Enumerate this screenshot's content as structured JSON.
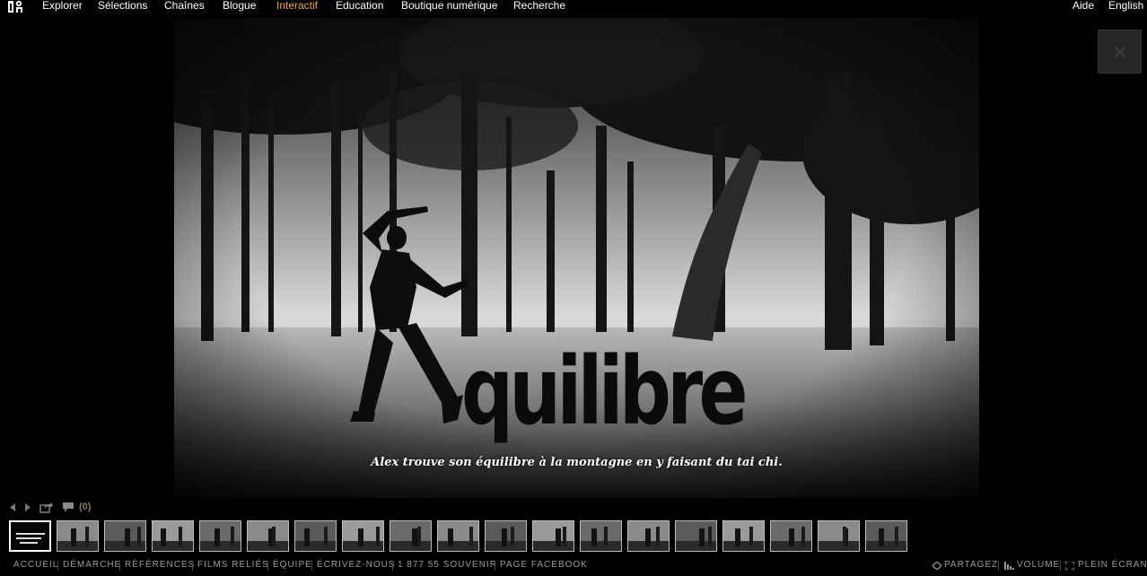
{
  "nav": {
    "items": [
      {
        "label": "Explorer",
        "active": false
      },
      {
        "label": "Sélections",
        "active": false
      },
      {
        "label": "Chaînes",
        "active": false
      },
      {
        "label": "Blogue",
        "active": false
      },
      {
        "label": "Interactif",
        "active": true
      },
      {
        "label": "Education",
        "active": false
      },
      {
        "label": "Boutique numérique",
        "active": false
      },
      {
        "label": "Recherche",
        "active": false
      }
    ],
    "right": [
      {
        "label": "Aide"
      },
      {
        "label": "English"
      }
    ]
  },
  "colors": {
    "accent": "#f0a43a",
    "background": "#000000",
    "muted": "#9a9a9a",
    "comment": "#8a7a52"
  },
  "slide": {
    "title_word": "quilibre",
    "caption": "Alex trouve son équilibre à la montagne en y faisant du tai chi."
  },
  "controls": {
    "comment_count": "(0)",
    "icons": [
      "prev-arrow-icon",
      "next-arrow-icon",
      "share-icon",
      "comment-icon"
    ]
  },
  "thumbnails": {
    "count": 19,
    "active_index": 0,
    "labels": [
      "",
      "",
      "",
      "",
      "",
      "",
      "",
      "",
      "",
      "",
      "",
      "",
      "",
      "",
      "",
      "",
      "",
      "",
      ""
    ]
  },
  "bottom": {
    "links": [
      {
        "label": "ACCUEIL"
      },
      {
        "label": "DÉMARCHE"
      },
      {
        "label": "RÉFÉRENCES"
      },
      {
        "label": "FILMS RELIÉS"
      },
      {
        "label": "ÉQUIPE"
      },
      {
        "label": "ÉCRIVEZ-NOUS"
      },
      {
        "label": "1 877 55 SOUVENIR"
      },
      {
        "label": "PAGE FACEBOOK"
      }
    ],
    "share_label": "PARTAGEZ",
    "volume_label": "VOLUME",
    "fullscreen_label": "PLEIN ÉCRAN"
  }
}
